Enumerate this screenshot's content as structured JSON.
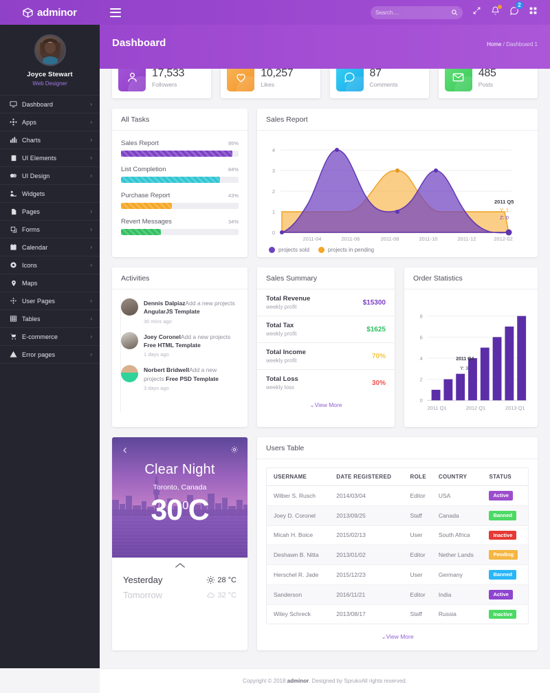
{
  "brand": {
    "name": "adminor",
    "logo_icon": "box-logo-icon"
  },
  "topbar": {
    "menu_icon": "hamburger-icon",
    "search": {
      "placeholder": "Search....",
      "value": "",
      "icon": "search-icon"
    },
    "icons": [
      {
        "name": "expand-icon",
        "badge": ""
      },
      {
        "name": "bell-icon",
        "badge": "dot"
      },
      {
        "name": "chat-icon",
        "badge": "2"
      },
      {
        "name": "grid-apps-icon",
        "badge": ""
      }
    ],
    "chat_badge_count": "2"
  },
  "sidebar": {
    "profile": {
      "name": "Joyce Stewart",
      "role": "Web Designer",
      "avatar": "user-avatar"
    },
    "items": [
      {
        "label": "Dashboard",
        "icon": "monitor-icon",
        "arrow": true
      },
      {
        "label": "Apps",
        "icon": "apps-icon",
        "arrow": true
      },
      {
        "label": "Charts",
        "icon": "chart-bar-icon",
        "arrow": true
      },
      {
        "label": "UI Elements",
        "icon": "ui-elements-icon",
        "arrow": true
      },
      {
        "label": "UI Design",
        "icon": "ui-design-icon",
        "arrow": true
      },
      {
        "label": "Widgets",
        "icon": "widgets-icon",
        "arrow": false
      },
      {
        "label": "Pages",
        "icon": "page-icon",
        "arrow": true
      },
      {
        "label": "Forms",
        "icon": "forms-icon",
        "arrow": true
      },
      {
        "label": "Calendar",
        "icon": "calendar-icon",
        "arrow": true
      },
      {
        "label": "Icons",
        "icon": "icons-icon",
        "arrow": true
      },
      {
        "label": "Maps",
        "icon": "map-pin-icon",
        "arrow": false
      },
      {
        "label": "User Pages",
        "icon": "user-pages-icon",
        "arrow": true
      },
      {
        "label": "Tables",
        "icon": "table-icon",
        "arrow": true
      },
      {
        "label": "E-commerce",
        "icon": "cart-icon",
        "arrow": true
      },
      {
        "label": "Error pages",
        "icon": "warning-icon",
        "arrow": true
      }
    ]
  },
  "page": {
    "title": "Dashboard",
    "breadcrumb_home": "Home",
    "breadcrumb_sep": "/",
    "breadcrumb_current": "Dashboard 1"
  },
  "stats": [
    {
      "value": "17,533",
      "label": "Followers",
      "icon": "user-icon",
      "color": "#9c4dcc"
    },
    {
      "value": "10,257",
      "label": "Likes",
      "icon": "heart-icon",
      "color": "#f5a33c"
    },
    {
      "value": "87",
      "label": "Comments",
      "icon": "comment-icon",
      "color": "#29b6f6"
    },
    {
      "value": "485",
      "label": "Posts",
      "icon": "envelope-icon",
      "color": "#4cd964"
    }
  ],
  "all_tasks": {
    "title": "All Tasks",
    "items": [
      {
        "name": "Sales Report",
        "pct": "95%",
        "value": 95,
        "color": "#7b3fc4"
      },
      {
        "name": "List Completion",
        "pct": "84%",
        "value": 84,
        "color": "#2ec5d3"
      },
      {
        "name": "Purchase Report",
        "pct": "43%",
        "value": 43,
        "color": "#f5a623"
      },
      {
        "name": "Revert Messages",
        "pct": "34%",
        "value": 34,
        "color": "#2fbf5f"
      }
    ]
  },
  "sales_report": {
    "title": "Sales Report"
  },
  "activities": {
    "title": "Activities",
    "items": [
      {
        "user": "Dennis Dalpiaz",
        "text": "Add a new projects ",
        "bold_text": "AngularJS Template",
        "time": "30 mins ago"
      },
      {
        "user": "Joey Coronel",
        "text": "Add a new projects ",
        "bold_text": "Free HTML Template",
        "time": "1 days ago"
      },
      {
        "user": "Norbert Bridwell",
        "text": "Add a new projects ",
        "bold_text": "Free PSD Template",
        "time": "3 days ago"
      }
    ]
  },
  "sales_summary": {
    "title": "Sales Summary",
    "rows": [
      {
        "name": "Total Revenue",
        "sub": "weekly profit",
        "value": "$15300",
        "color": "#7b3fc4"
      },
      {
        "name": "Total Tax",
        "sub": "weekly profit",
        "value": "$1625",
        "color": "#2fbf5f"
      },
      {
        "name": "Total Income",
        "sub": "weekly profit",
        "value": "70%",
        "color": "#f5c542"
      },
      {
        "name": "Total Loss",
        "sub": "weekly loss",
        "value": "30%",
        "color": "#ef5350"
      }
    ],
    "view_more": "View More"
  },
  "order_statistics": {
    "title": "Order Statistics"
  },
  "weather": {
    "condition": "Clear Night",
    "location": "Toronto, Canada",
    "temp": "30",
    "degree": "0",
    "unit": "C",
    "back_icon": "chevron-left-icon",
    "settings_icon": "gear-icon",
    "collapse_icon": "chevron-up-icon",
    "rows": [
      {
        "day": "Yesterday",
        "icon": "sun-icon",
        "temp": "28",
        "unit": "°C",
        "dim": false
      },
      {
        "day": "Tomorrow",
        "icon": "cloud-icon",
        "temp": "32",
        "unit": "°C",
        "dim": true
      }
    ]
  },
  "users_table": {
    "title": "Users Table",
    "columns": [
      "USERNAME",
      "DATE REGISTERED",
      "ROLE",
      "COUNTRY",
      "STATUS"
    ],
    "rows": [
      {
        "username": "Wilber S. Rusch",
        "date": "2014/03/04",
        "role": "Editor",
        "country": "USA",
        "status": "Active",
        "status_color": "#9c4dcc"
      },
      {
        "username": "Joey D. Coronel",
        "date": "2013/09/25",
        "role": "Staff",
        "country": "Canada",
        "status": "Banned",
        "status_color": "#4cd964"
      },
      {
        "username": "Micah H. Boice",
        "date": "2015/02/13",
        "role": "User",
        "country": "South Africa",
        "status": "Inactive",
        "status_color": "#e53935"
      },
      {
        "username": "Deshawn B. Nitta",
        "date": "2013/01/02",
        "role": "Editor",
        "country": "Nether Lands",
        "status": "Pending",
        "status_color": "#f5b642"
      },
      {
        "username": "Herschel R. Jade",
        "date": "2015/12/23",
        "role": "User",
        "country": "Germany",
        "status": "Banned",
        "status_color": "#29b6f6"
      },
      {
        "username": "Sanderson",
        "date": "2016/11/21",
        "role": "Editor",
        "country": "India",
        "status": "Active",
        "status_color": "#8e44d0"
      },
      {
        "username": "Wiley Schreck",
        "date": "2013/08/17",
        "role": "Staff",
        "country": "Russia",
        "status": "Inactive",
        "status_color": "#4cd964"
      }
    ],
    "view_more": "View More"
  },
  "footer": {
    "copyright": "Copyright © 2018 ",
    "brand": "adminor",
    "rest": ". Designed by SprukoAll rights reserved."
  },
  "chart_data": [
    {
      "type": "area",
      "title": "Sales Report",
      "x": [
        "2011-03",
        "2011-04",
        "2011-05",
        "2011-06",
        "2011-07",
        "2011-08",
        "2011-09",
        "2011-10",
        "2011-11",
        "2011-12",
        "2012-01",
        "2012-02",
        "2012-03"
      ],
      "tick_labels": [
        "2011-04",
        "2011-06",
        "2011-08",
        "2011-10",
        "2011-12",
        "2012-02"
      ],
      "series": [
        {
          "name": "projects sold",
          "color": "#6f42c1",
          "values": [
            0,
            1,
            2.6,
            4,
            2.6,
            1.2,
            1,
            1.4,
            2.6,
            3,
            2.3,
            1,
            0
          ]
        },
        {
          "name": "projects in pending",
          "color": "#f5a623",
          "values": [
            1,
            1,
            1,
            1,
            1.6,
            2.6,
            3,
            2.4,
            1.3,
            1,
            1,
            1,
            0
          ]
        }
      ],
      "ylim": [
        0,
        4
      ],
      "yticks": [
        0,
        1,
        2,
        3,
        4
      ],
      "xlabel": "",
      "ylabel": "",
      "grid": true,
      "legend_position": "bottom-left",
      "annotation": {
        "label": "2011 Q5",
        "y_value": "Y: 1",
        "z_value": "Z: 0"
      }
    },
    {
      "type": "bar",
      "title": "Order Statistics",
      "categories": [
        "2011 Q1",
        "2011 Q2",
        "2011 Q3",
        "2011 Q4",
        "2012 Q1",
        "2012 Q2",
        "2012 Q3",
        "2013 Q1"
      ],
      "tick_labels": [
        "2011 Q1",
        "2012 Q1",
        "2013 Q1"
      ],
      "values": [
        1,
        2,
        2.5,
        4,
        5,
        6,
        7,
        8
      ],
      "color": "#6f42c1",
      "ylim": [
        0,
        8
      ],
      "yticks": [
        0,
        2,
        4,
        6,
        8
      ],
      "xlabel": "",
      "ylabel": "",
      "grid": true,
      "annotation": {
        "label": "2011 Q4",
        "y_value": "Y: 3"
      }
    }
  ]
}
